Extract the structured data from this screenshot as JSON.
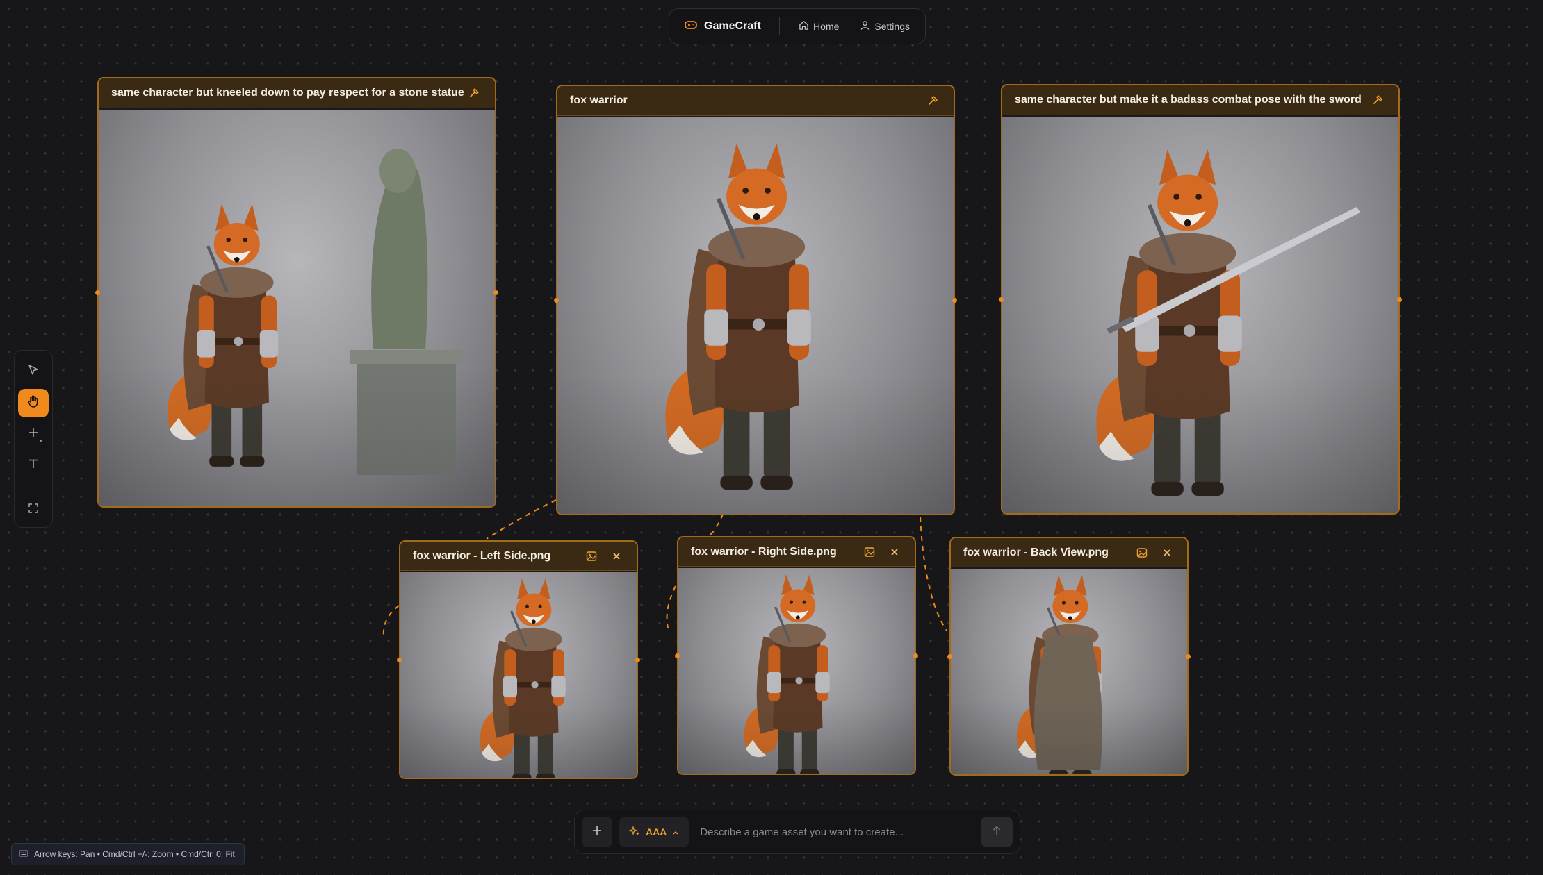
{
  "nav": {
    "brand": "GameCraft",
    "home": "Home",
    "settings": "Settings"
  },
  "toolbar": {
    "tools": [
      "select-tool",
      "pan-tool",
      "add-tool",
      "text-tool",
      "fit-tool"
    ],
    "active": "pan-tool"
  },
  "cards": {
    "kneel": {
      "title": "same character but kneeled down to pay respect for a stone statue"
    },
    "main": {
      "title": "fox warrior"
    },
    "combat": {
      "title": "same character but make it a badass combat pose with the sword"
    },
    "left": {
      "title": "fox warrior - Left Side.png"
    },
    "right": {
      "title": "fox warrior - Right Side.png"
    },
    "back": {
      "title": "fox warrior - Back View.png"
    }
  },
  "prompt": {
    "model": "AAA",
    "placeholder": "Describe a game asset you want to create..."
  },
  "hint": "Arrow keys: Pan • Cmd/Ctrl +/-: Zoom • Cmd/Ctrl 0: Fit",
  "colors": {
    "accent": "#f08a1c",
    "card_border": "#a06c1b",
    "card_header": "#3a2a14",
    "canvas": "#17171a"
  }
}
